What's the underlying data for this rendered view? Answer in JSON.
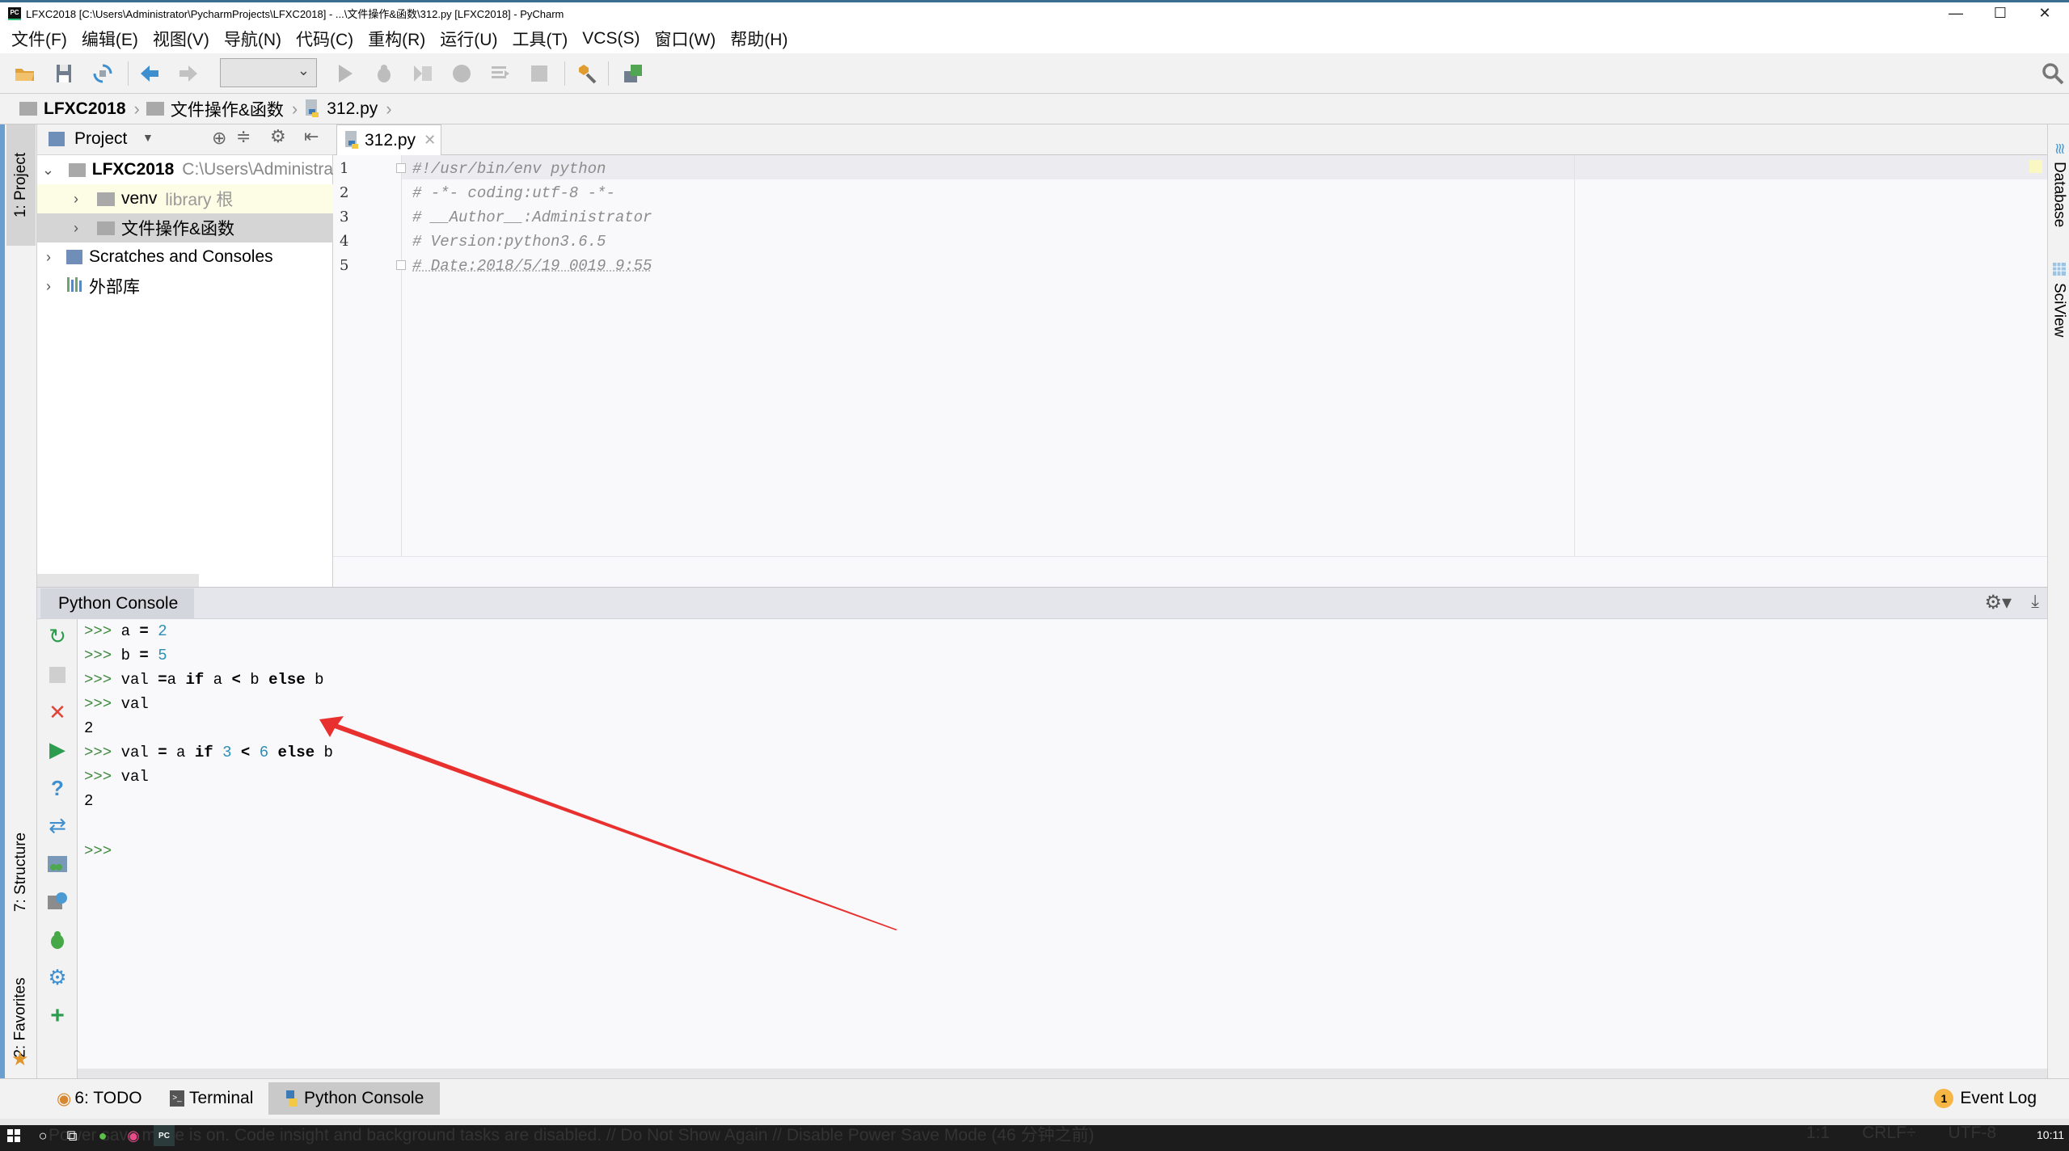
{
  "window": {
    "title": "LFXC2018 [C:\\Users\\Administrator\\PycharmProjects\\LFXC2018] - ...\\文件操作&函数\\312.py [LFXC2018] - PyCharm",
    "app_icon": "PC",
    "minimize_glyph": "—",
    "maximize_glyph": "☐",
    "close_glyph": "✕"
  },
  "menu": [
    "文件(F)",
    "编辑(E)",
    "视图(V)",
    "导航(N)",
    "代码(C)",
    "重构(R)",
    "运行(U)",
    "工具(T)",
    "VCS(S)",
    "窗口(W)",
    "帮助(H)"
  ],
  "toolbar": {
    "icons": [
      "open-folder-icon",
      "save-icon",
      "sync-icon",
      "back-icon",
      "forward-icon",
      "run-config-dropdown",
      "run-icon",
      "debug-icon",
      "coverage-icon",
      "profile-icon",
      "concurrency-icon",
      "stop-icon",
      "settings-wrench-icon",
      "sdk-icon"
    ],
    "run_config_value": "",
    "search_icon": "search-icon"
  },
  "breadcrumb": [
    "LFXC2018",
    "文件操作&函数",
    "312.py"
  ],
  "left_strip": {
    "tabs": [
      "1: Project",
      "7: Structure",
      "2: Favorites"
    ]
  },
  "right_strip": {
    "tabs": [
      "Database",
      "SciView"
    ]
  },
  "project_panel": {
    "title": "Project",
    "tree": [
      {
        "label": "LFXC2018",
        "hint": "C:\\Users\\Administra",
        "expanded": true,
        "bold": true,
        "level": 0
      },
      {
        "label": "venv",
        "hint": "library 根",
        "expanded": false,
        "level": 1
      },
      {
        "label": "文件操作&函数",
        "hint": "",
        "expanded": false,
        "level": 1,
        "selected": true
      },
      {
        "label": "Scratches and Consoles",
        "hint": "",
        "expanded": false,
        "level": 0
      },
      {
        "label": "外部库",
        "hint": "",
        "expanded": false,
        "level": 0
      }
    ]
  },
  "editor": {
    "tab_label": "312.py",
    "lines": [
      {
        "n": "1",
        "text": "#!/usr/bin/env python"
      },
      {
        "n": "2",
        "text": "# -*- coding:utf-8 -*-"
      },
      {
        "n": "3",
        "text": "# __Author__:Administrator"
      },
      {
        "n": "4",
        "text": "# Version:python3.6.5"
      },
      {
        "n": "5",
        "text": "# Date:2018/5/19 0019 9:55"
      }
    ]
  },
  "console": {
    "title": "Python Console",
    "prompt": ">>>",
    "lines": [
      {
        "type": "in",
        "tokens": [
          [
            "a",
            ""
          ],
          [
            " = ",
            "kw"
          ],
          [
            "2",
            "num"
          ]
        ]
      },
      {
        "type": "in",
        "tokens": [
          [
            "b",
            ""
          ],
          [
            " = ",
            "kw"
          ],
          [
            "5",
            "num"
          ]
        ]
      },
      {
        "type": "in",
        "tokens": [
          [
            "val ",
            ""
          ],
          [
            "=",
            "kw"
          ],
          [
            "a ",
            ""
          ],
          [
            "if",
            "kw"
          ],
          [
            " a ",
            ""
          ],
          [
            "<",
            "kw"
          ],
          [
            " b ",
            ""
          ],
          [
            "else",
            "kw"
          ],
          [
            " b",
            ""
          ]
        ]
      },
      {
        "type": "in",
        "tokens": [
          [
            "val",
            ""
          ]
        ]
      },
      {
        "type": "out",
        "text": "2"
      },
      {
        "type": "in",
        "tokens": [
          [
            "val ",
            ""
          ],
          [
            "=",
            "kw"
          ],
          [
            " a ",
            ""
          ],
          [
            "if",
            "kw"
          ],
          [
            " ",
            ""
          ],
          [
            "3",
            "num"
          ],
          [
            " ",
            ""
          ],
          [
            "<",
            "kw"
          ],
          [
            " ",
            ""
          ],
          [
            "6",
            "num"
          ],
          [
            " ",
            ""
          ],
          [
            "else",
            "kw"
          ],
          [
            " b",
            ""
          ]
        ]
      },
      {
        "type": "in",
        "tokens": [
          [
            "val",
            ""
          ]
        ]
      },
      {
        "type": "out",
        "text": "2"
      },
      {
        "type": "blank"
      },
      {
        "type": "in",
        "tokens": []
      }
    ],
    "tool_icons": [
      "rerun-icon",
      "stop-icon",
      "close-icon",
      "execute-icon",
      "help-icon",
      "soft-wrap-icon",
      "show-variables-icon",
      "history-icon",
      "debug-icon",
      "settings-icon",
      "new-console-icon"
    ]
  },
  "bottom_tabs": [
    {
      "label": "6: TODO",
      "active": false
    },
    {
      "label": "Terminal",
      "active": false
    },
    {
      "label": "Python Console",
      "active": true
    }
  ],
  "event_log": {
    "label": "Event Log",
    "count": "1"
  },
  "status": {
    "message": "Power save mode is on. Code insight and background tasks are disabled. // Do Not Show Again // Disable Power Save Mode (46 分钟之前)",
    "position": "1:1",
    "line_sep": "CRLF÷",
    "encoding": "UTF-8",
    "clock": "10:11"
  },
  "colors": {
    "accent_blue": "#6b9fd0",
    "prompt_green": "#3d8a3d",
    "number_blue": "#2a8fb5",
    "annotation_red": "#e8312f",
    "comment_gray": "#8c8c8c"
  }
}
